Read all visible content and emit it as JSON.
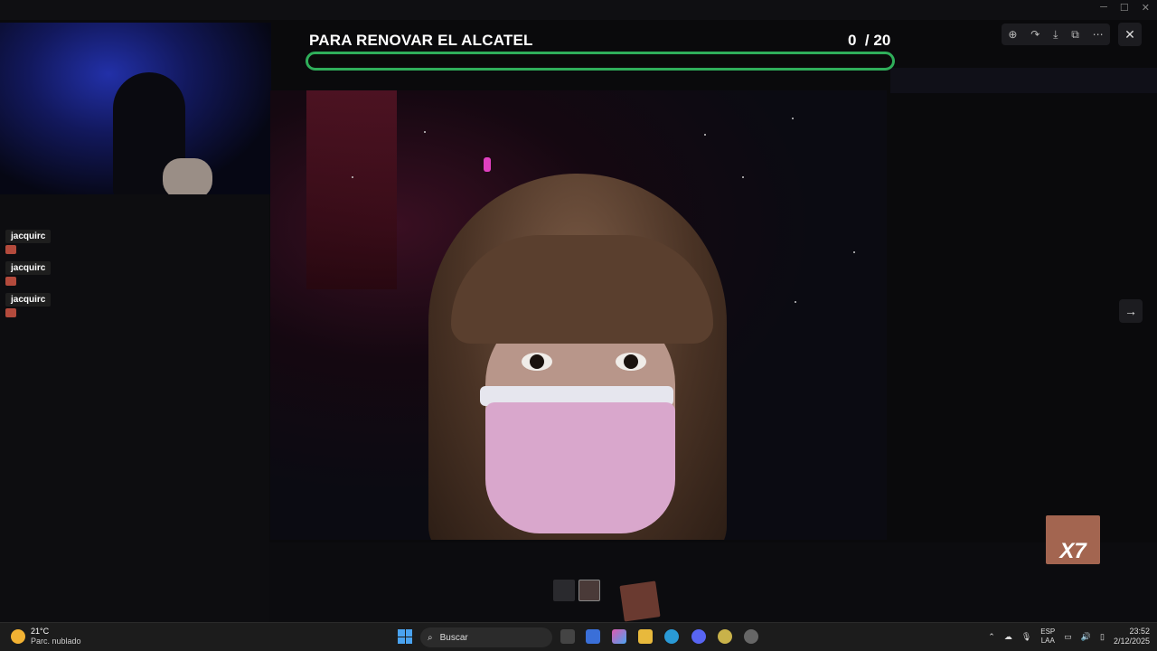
{
  "overlay": {
    "title": "PARA RENOVAR EL ALCATEL",
    "count": "0",
    "total": "/ 20",
    "progress_fraction": 0.0,
    "bar_color": "#2fae5a"
  },
  "chat": {
    "messages": [
      {
        "user": "jacquirc"
      },
      {
        "user": "jacquirc"
      },
      {
        "user": "jacquirc"
      }
    ]
  },
  "viewer": {
    "tools": [
      "zoom-icon",
      "forward-icon",
      "download-icon",
      "open-external-icon",
      "more-icon"
    ],
    "close_icon": "close-icon",
    "next_icon": "arrow-right-icon"
  },
  "corner_emote": {
    "label": "X7"
  },
  "taskbar": {
    "weather_temp": "21°C",
    "weather_desc": "Parc. nublado",
    "search_placeholder": "Buscar",
    "lang_top": "ESP",
    "lang_bottom": "LAA",
    "time": "23:52",
    "date": "2/12/2025"
  },
  "colors": {
    "accent": "#2fae5a",
    "taskbar_bg": "#1c1c1c"
  }
}
